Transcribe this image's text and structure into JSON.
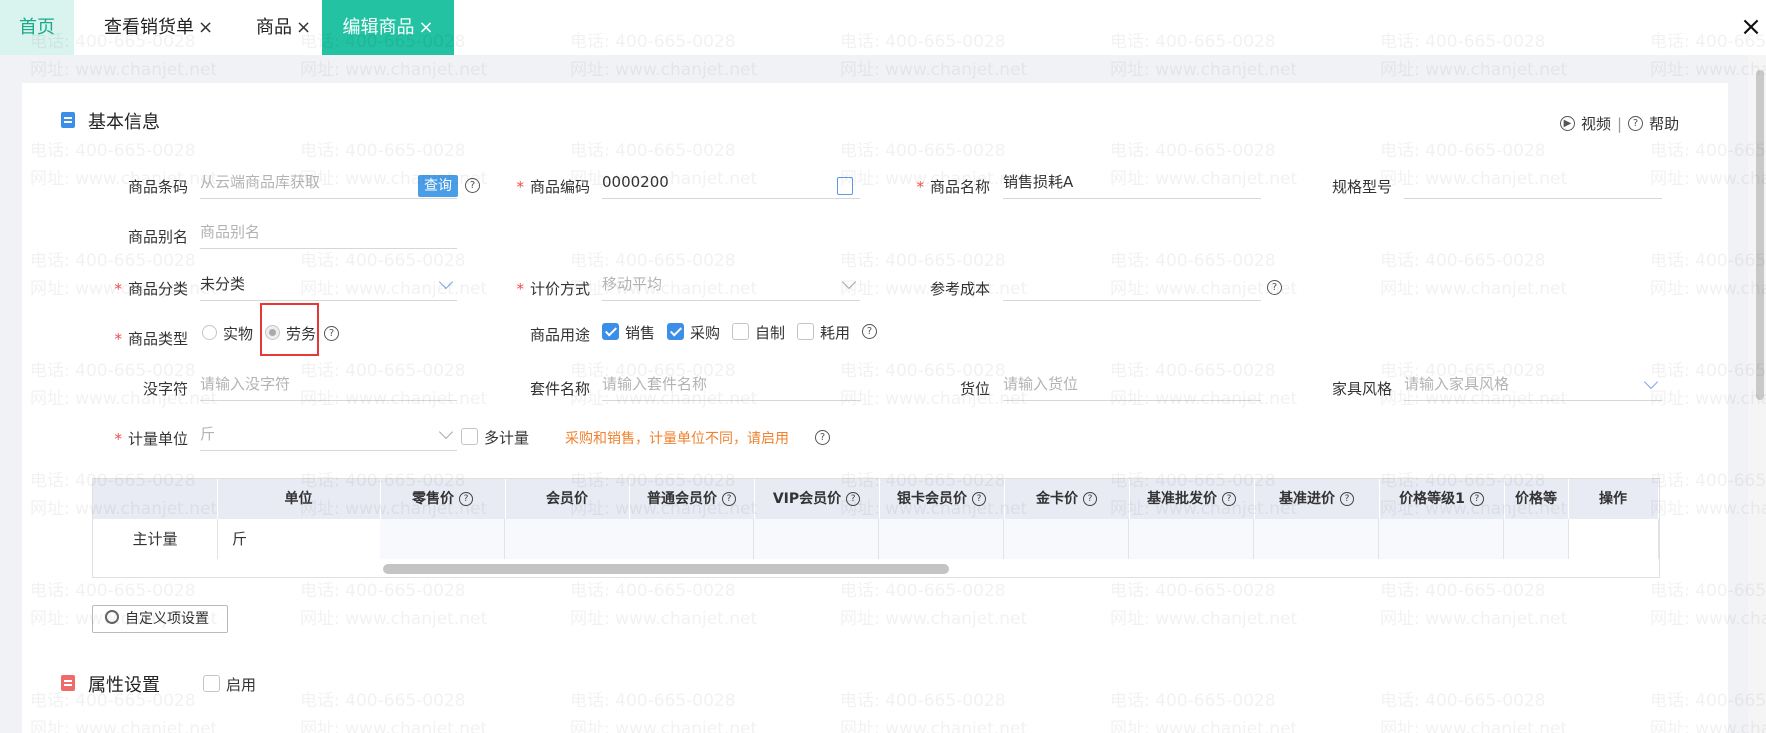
{
  "tabs": {
    "home": "首页",
    "sale": "查看销货单",
    "goods": "商品",
    "edit": "编辑商品",
    "close_glyph": "×"
  },
  "window": {
    "close_glyph": "×"
  },
  "basic": {
    "title": "基本信息",
    "video": "视频",
    "help": "帮助",
    "separator": "|"
  },
  "form": {
    "barcode": {
      "label": "商品条码",
      "placeholder": "从云端商品库获取",
      "button": "查询"
    },
    "code": {
      "label": "商品编码",
      "value": "0000200"
    },
    "name": {
      "label": "商品名称",
      "value": "销售损耗A"
    },
    "spec": {
      "label": "规格型号",
      "value": ""
    },
    "alias": {
      "label": "商品别名",
      "placeholder": "商品别名"
    },
    "category": {
      "label": "商品分类",
      "value": "未分类"
    },
    "pricing": {
      "label": "计价方式",
      "value": "移动平均"
    },
    "ref_cost": {
      "label": "参考成本",
      "value": ""
    },
    "type": {
      "label": "商品类型",
      "options": [
        "实物",
        "劳务"
      ],
      "selected": "劳务"
    },
    "usage": {
      "label": "商品用途",
      "options": [
        {
          "label": "销售",
          "checked": true
        },
        {
          "label": "采购",
          "checked": true
        },
        {
          "label": "自制",
          "checked": false
        },
        {
          "label": "耗用",
          "checked": false
        }
      ]
    },
    "no_char": {
      "label": "没字符",
      "placeholder": "请输入没字符"
    },
    "kit": {
      "label": "套件名称",
      "placeholder": "请输入套件名称"
    },
    "location": {
      "label": "货位",
      "placeholder": "请输入货位"
    },
    "style": {
      "label": "家具风格",
      "placeholder": "请输入家具风格"
    },
    "unit": {
      "label": "计量单位",
      "value": "斤"
    },
    "multi_unit": {
      "label": "多计量"
    },
    "unit_note": "采购和销售，计量单位不同，请启用",
    "required_mark": "*"
  },
  "price_table": {
    "headers": [
      "单位",
      "零售价",
      "会员价",
      "普通会员价",
      "VIP会员价",
      "银卡会员价",
      "金卡价",
      "基准批发价",
      "基准进价",
      "价格等级1",
      "价格等",
      "操作"
    ],
    "row": {
      "label": "主计量",
      "unit": "斤"
    }
  },
  "custom_button": "自定义项设置",
  "attr": {
    "title": "属性设置",
    "enable": "启用"
  },
  "watermark": {
    "phone": "电话: 400-665-0028",
    "site": "网址: www.chanjet.net"
  },
  "help_glyph": "?",
  "colors": {
    "accent_teal": "#22c2a2",
    "home_tab_bg": "#d9f3ee",
    "checkbox_blue": "#3b8fe8",
    "required_red": "#f04b4b",
    "note_orange": "#f0822e",
    "highlight_red": "#e53935",
    "table_header": "#e8eaf4"
  }
}
